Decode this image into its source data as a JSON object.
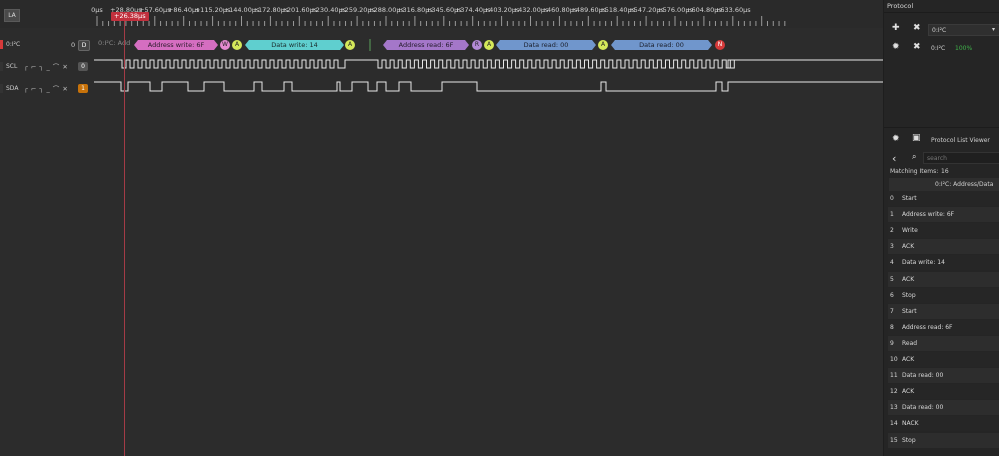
{
  "ruler": {
    "la_label": "LA",
    "ticks": [
      "0µs",
      "+28.80µs",
      "+57.60µs",
      "+86.40µs",
      "+115.20µs",
      "+144.00µs",
      "+172.80µs",
      "+201.60µs",
      "+230.40µs",
      "+259.20µs",
      "+288.00µs",
      "+316.80µs",
      "+345.60µs",
      "+374.40µs",
      "+403.20µs",
      "+432.00µs",
      "+460.80µs",
      "+489.60µs",
      "+518.40µs",
      "+547.20µs",
      "+576.00µs",
      "+604.80µs",
      "+633.60µs"
    ],
    "cursor": "+26.38µs"
  },
  "channels": {
    "i2c": {
      "name": "0:I²C",
      "value": "0",
      "badge": "D",
      "decode_prefix": "0:I²C: Add",
      "color": "#d63a3a"
    },
    "scl": {
      "name": "SCL",
      "value": "0",
      "color": "#2a2a2a"
    },
    "sda": {
      "name": "SDA",
      "value": "1",
      "color": "#c7720a"
    }
  },
  "decodes": {
    "addr_write": "Address write: 6F",
    "w": "W",
    "a1": "A",
    "data_write": "Data write: 14",
    "a2": "A",
    "addr_read": "Address read: 6F",
    "r": "R",
    "a3": "A",
    "data_read1": "Data read: 00",
    "a4": "A",
    "data_read2": "Data read: 00",
    "n": "N"
  },
  "colors": {
    "addr": "#d56ec1",
    "data_write": "#5fcfcf",
    "addr_read": "#a477c9",
    "data_read": "#7096cc",
    "ack": "#d4e85a",
    "nack": "#d63a3a",
    "write_bit": "#e48ad0",
    "read_bit": "#b48ad6"
  },
  "protocol_panel": {
    "title": "Protocol",
    "protocol_name": "0:I²C",
    "protocol_row2": "0:I²C",
    "status": "100%"
  },
  "list_viewer": {
    "title": "Protocol List Viewer",
    "search_placeholder": "search",
    "matching_label": "Matching Items:",
    "matching_count": "16",
    "column_header": "0:I²C: Address/Data",
    "rows": [
      {
        "n": "0",
        "t": "Start"
      },
      {
        "n": "1",
        "t": "Address write: 6F"
      },
      {
        "n": "2",
        "t": "Write"
      },
      {
        "n": "3",
        "t": "ACK"
      },
      {
        "n": "4",
        "t": "Data write: 14"
      },
      {
        "n": "5",
        "t": "ACK"
      },
      {
        "n": "6",
        "t": "Stop"
      },
      {
        "n": "7",
        "t": "Start"
      },
      {
        "n": "8",
        "t": "Address read: 6F"
      },
      {
        "n": "9",
        "t": "Read"
      },
      {
        "n": "10",
        "t": "ACK"
      },
      {
        "n": "11",
        "t": "Data read: 00"
      },
      {
        "n": "12",
        "t": "ACK"
      },
      {
        "n": "13",
        "t": "Data read: 00"
      },
      {
        "n": "14",
        "t": "NACK"
      },
      {
        "n": "15",
        "t": "Stop"
      }
    ]
  }
}
